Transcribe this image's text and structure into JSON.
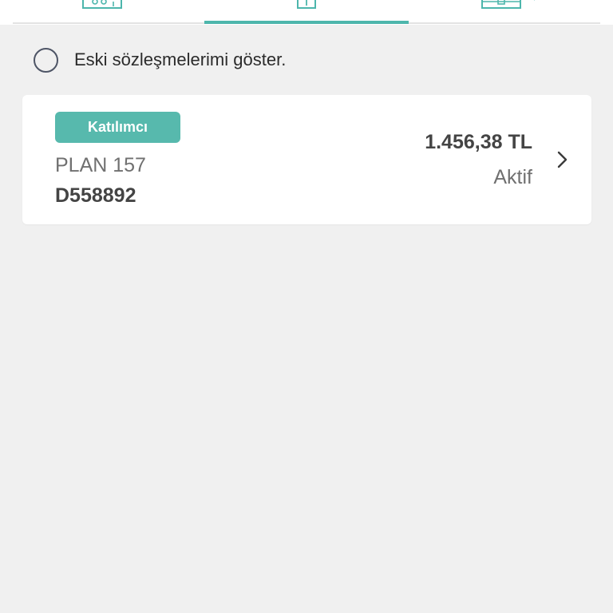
{
  "tabs": [
    {
      "icon": "people-icon"
    },
    {
      "icon": "document-icon",
      "active": true
    },
    {
      "icon": "briefcase-icon"
    }
  ],
  "filter": {
    "show_old_contracts_label": "Eski sözleşmelerimi göster.",
    "checked": false
  },
  "contracts": [
    {
      "role_badge": "Katılımcı",
      "plan_name": "PLAN 157",
      "contract_number": "D558892",
      "amount": "1.456,38 TL",
      "status": "Aktif"
    }
  ],
  "colors": {
    "accent": "#4db6ac",
    "badge": "#57b9ad",
    "background": "#f0f0f0",
    "card": "#ffffff"
  }
}
